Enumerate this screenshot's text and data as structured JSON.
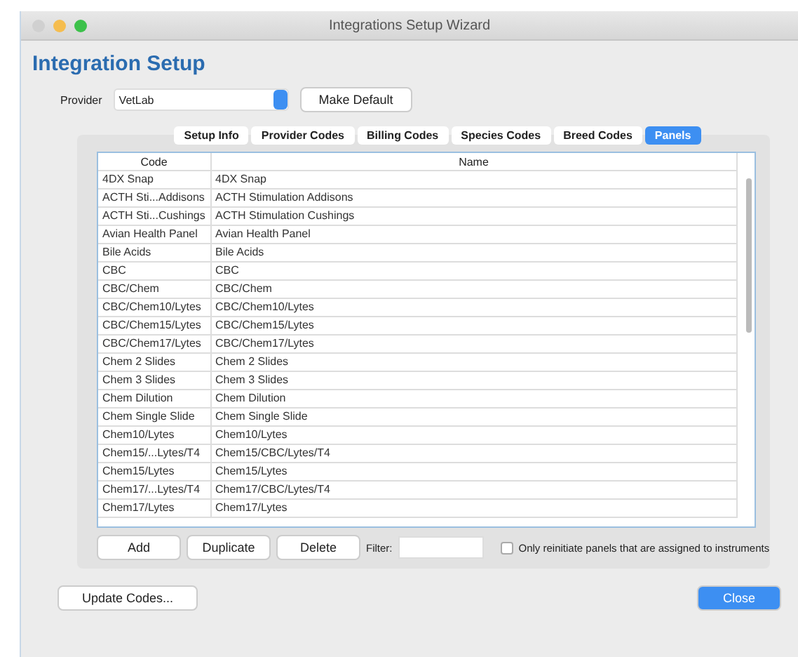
{
  "window": {
    "title": "Integrations Setup Wizard"
  },
  "heading": "Integration Setup",
  "provider": {
    "label": "Provider",
    "value": "VetLab",
    "default_button": "Make Default"
  },
  "tabs": [
    {
      "label": "Setup Info",
      "selected": false
    },
    {
      "label": "Provider Codes",
      "selected": false
    },
    {
      "label": "Billing Codes",
      "selected": false
    },
    {
      "label": "Species Codes",
      "selected": false
    },
    {
      "label": "Breed Codes",
      "selected": false
    },
    {
      "label": "Panels",
      "selected": true
    }
  ],
  "table": {
    "columns": [
      "Code",
      "Name"
    ],
    "rows": [
      [
        "4DX Snap",
        "4DX Snap"
      ],
      [
        "ACTH Sti...Addisons",
        "ACTH Stimulation Addisons"
      ],
      [
        "ACTH Sti...Cushings",
        "ACTH Stimulation Cushings"
      ],
      [
        "Avian Health Panel",
        "Avian Health Panel"
      ],
      [
        "Bile Acids",
        "Bile Acids"
      ],
      [
        "CBC",
        "CBC"
      ],
      [
        "CBC/Chem",
        "CBC/Chem"
      ],
      [
        "CBC/Chem10/Lytes",
        "CBC/Chem10/Lytes"
      ],
      [
        "CBC/Chem15/Lytes",
        "CBC/Chem15/Lytes"
      ],
      [
        "CBC/Chem17/Lytes",
        "CBC/Chem17/Lytes"
      ],
      [
        "Chem 2 Slides",
        "Chem 2 Slides"
      ],
      [
        "Chem 3 Slides",
        "Chem 3 Slides"
      ],
      [
        "Chem Dilution",
        "Chem Dilution"
      ],
      [
        "Chem Single Slide",
        "Chem Single Slide"
      ],
      [
        "Chem10/Lytes",
        "Chem10/Lytes"
      ],
      [
        "Chem15/...Lytes/T4",
        "Chem15/CBC/Lytes/T4"
      ],
      [
        "Chem15/Lytes",
        "Chem15/Lytes"
      ],
      [
        "Chem17/...Lytes/T4",
        "Chem17/CBC/Lytes/T4"
      ],
      [
        "Chem17/Lytes",
        "Chem17/Lytes"
      ]
    ]
  },
  "actions": [
    "Add",
    "Duplicate",
    "Delete"
  ],
  "filter": {
    "label": "Filter:"
  },
  "only_assigned": {
    "label": "Only reinitiate panels that are assigned to instruments",
    "checked": false
  },
  "footer": {
    "update_button": "Update Codes...",
    "close_button": "Close"
  }
}
